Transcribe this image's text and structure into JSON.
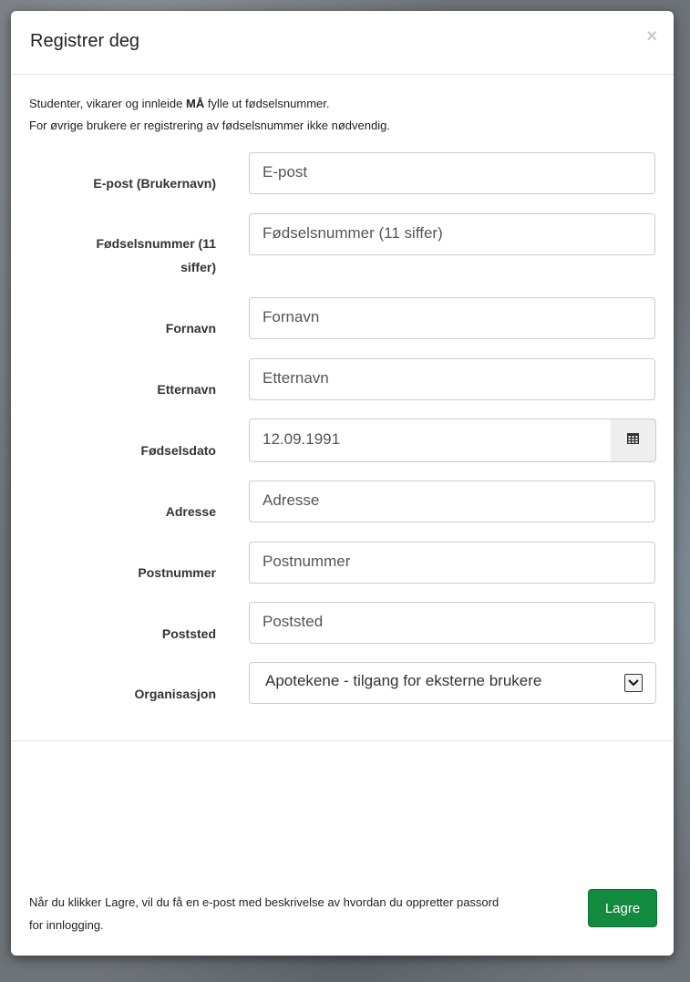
{
  "modal": {
    "title": "Registrer deg",
    "close_symbol": "×",
    "close_icon": "close-icon"
  },
  "intro": {
    "line1_pre": "Studenter, vikarer og innleide ",
    "line1_bold": "MÅ",
    "line1_post": " fylle ut fødselsnummer.",
    "line2": "For øvrige brukere er registrering av fødselsnummer ikke nødvendig."
  },
  "fields": {
    "email": {
      "label": "E-post (Brukernavn)",
      "placeholder": "E-post"
    },
    "ssn": {
      "label_line1": "Fødselsnummer (11",
      "label_line2": "siffer)",
      "placeholder": "Fødselsnummer (11 siffer)"
    },
    "firstname": {
      "label": "Fornavn",
      "placeholder": "Fornavn"
    },
    "lastname": {
      "label": "Etternavn",
      "placeholder": "Etternavn"
    },
    "birthdate": {
      "label": "Fødselsdato",
      "value": "12.09.1991",
      "icon": "calendar-icon"
    },
    "address": {
      "label": "Adresse",
      "placeholder": "Adresse"
    },
    "postcode": {
      "label": "Postnummer",
      "placeholder": "Postnummer"
    },
    "city": {
      "label": "Poststed",
      "placeholder": "Poststed"
    },
    "organisation": {
      "label": "Organisasjon",
      "selected": "Apotekene - tilgang for eksterne brukere",
      "icon": "chevron-down-icon"
    }
  },
  "footer": {
    "text": "Når du klikker Lagre, vil du få en e-post med beskrivelse av hvordan du oppretter passord for innlogging.",
    "save_label": "Lagre"
  },
  "colors": {
    "save_button": "#128a3f",
    "backdrop": "#6e7378"
  }
}
